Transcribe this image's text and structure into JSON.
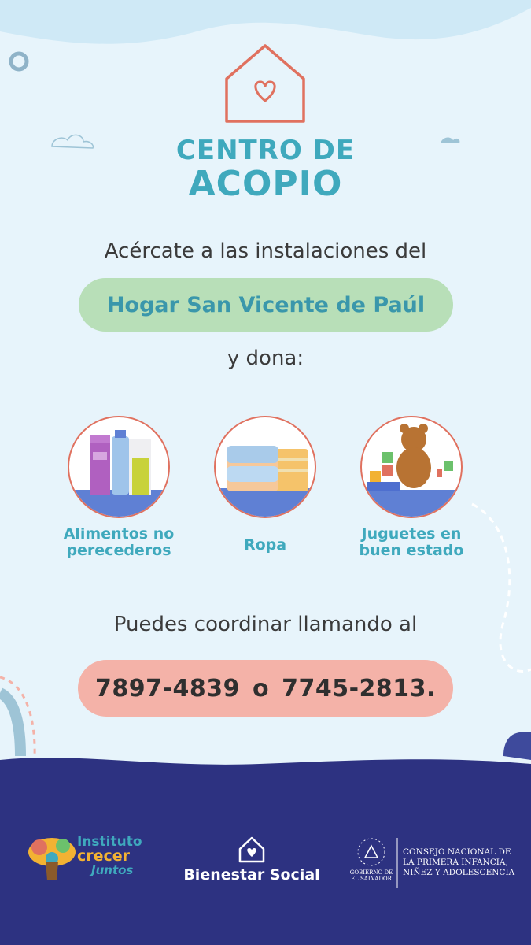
{
  "header": {
    "title_line1": "CENTRO DE",
    "title_line2": "ACOPIO",
    "house_icon": "house-heart-icon"
  },
  "intro_text": "Acércate a las instalaciones del",
  "place_name": "Hogar San Vicente de Paúl",
  "donate_text": "y dona:",
  "items": [
    {
      "label_line1": "Alimentos no",
      "label_line2": "perecederos",
      "icon": "groceries-icon"
    },
    {
      "label_line1": "Ropa",
      "label_line2": "",
      "icon": "folded-clothes-icon"
    },
    {
      "label_line1": "Juguetes en",
      "label_line2": "buen estado",
      "icon": "toys-icon"
    }
  ],
  "coordinate_text": "Puedes coordinar llamando al",
  "phones": {
    "phone1": "7897-4839",
    "connector": "o",
    "phone2": "7745-2813."
  },
  "footer": {
    "logo1_line1": "Instituto",
    "logo1_line2": "crecer",
    "logo1_line3": "Juntos",
    "logo2": "Bienestar Social",
    "gov_line1": "GOBIERNO DE",
    "gov_line2": "EL SALVADOR",
    "council_line1": "CONSEJO NACIONAL DE",
    "council_line2": "LA PRIMERA INFANCIA,",
    "council_line3": "NIÑEZ Y ADOLESCENCIA"
  },
  "colors": {
    "background": "#e7f4fb",
    "accent_teal": "#3fa9bd",
    "accent_coral": "#e0715f",
    "pill_green": "#b8dfb8",
    "pill_pink": "#f4b2a8",
    "footer_navy": "#2d3281"
  }
}
